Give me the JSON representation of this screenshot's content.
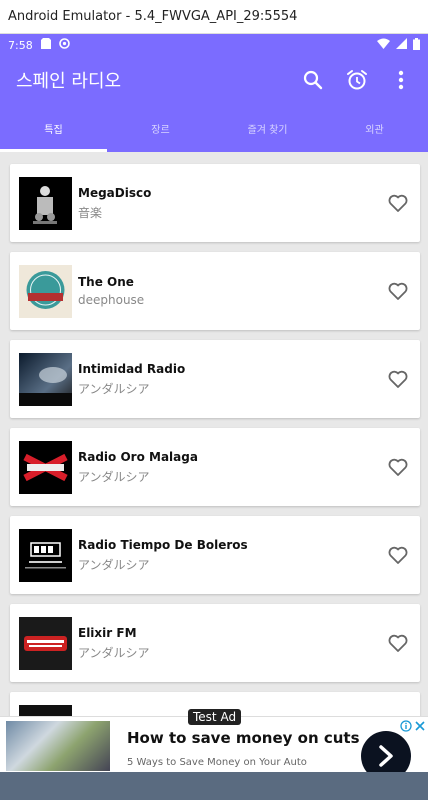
{
  "window": {
    "title": "Android Emulator - 5.4_FWVGA_API_29:5554"
  },
  "statusbar": {
    "time": "7:58"
  },
  "appbar": {
    "title": "스페인 라디오",
    "actions": [
      "search-icon",
      "alarm-icon",
      "more-vert-icon"
    ]
  },
  "tabs": [
    {
      "label": "특집",
      "active": true
    },
    {
      "label": "장르",
      "active": false
    },
    {
      "label": "즐겨 찾기",
      "active": false
    },
    {
      "label": "외관",
      "active": false
    }
  ],
  "stations": [
    {
      "title": "MegaDisco",
      "subtitle": "音楽"
    },
    {
      "title": "The One",
      "subtitle": "deephouse"
    },
    {
      "title": "Intimidad Radio",
      "subtitle": "アンダルシア"
    },
    {
      "title": "Radio Oro Malaga",
      "subtitle": "アンダルシア"
    },
    {
      "title": "Radio Tiempo De Boleros",
      "subtitle": "アンダルシア"
    },
    {
      "title": "Elixir FM",
      "subtitle": "アンダルシア"
    }
  ],
  "ad": {
    "label": "Test Ad",
    "headline": "How to save money on cuts",
    "subtext": "5 Ways to Save Money on Your Auto"
  },
  "colors": {
    "primary": "#7b6cff",
    "background": "#e8e8e8"
  }
}
